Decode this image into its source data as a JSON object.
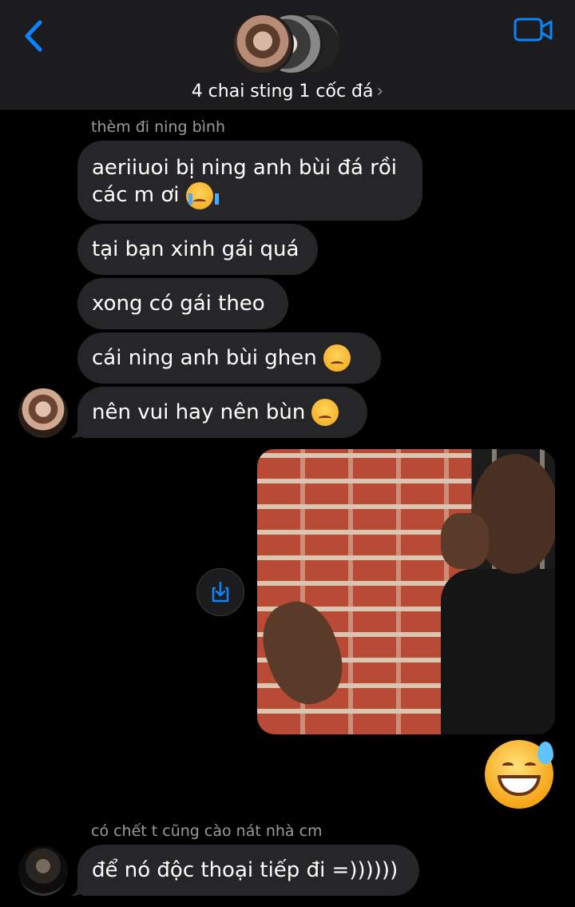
{
  "header": {
    "title": "4 chai sting 1 cốc đá",
    "back_icon": "chevron-left-icon",
    "video_icon": "video-camera-icon",
    "accent": "#0a84ff"
  },
  "messages": {
    "group1_sender": "thèm đi ning bình",
    "m1_line1": "aeriiuoi bị ning anh bùi đá rồi",
    "m1_line2": "các m ơi",
    "m2": "tại bạn xinh gái quá",
    "m3": "xong có gái theo",
    "m4": "cái ning anh bùi ghen",
    "m5": "nên vui hay nên bùn",
    "group2_sender": "có chết t cũng cào nát nhà cm",
    "m6": "để nó độc thoại tiếp đi =))))))"
  },
  "colors": {
    "background": "#000000",
    "bubble": "#262628",
    "header": "#1c1c1e",
    "sender_label": "#9a9aa0"
  }
}
